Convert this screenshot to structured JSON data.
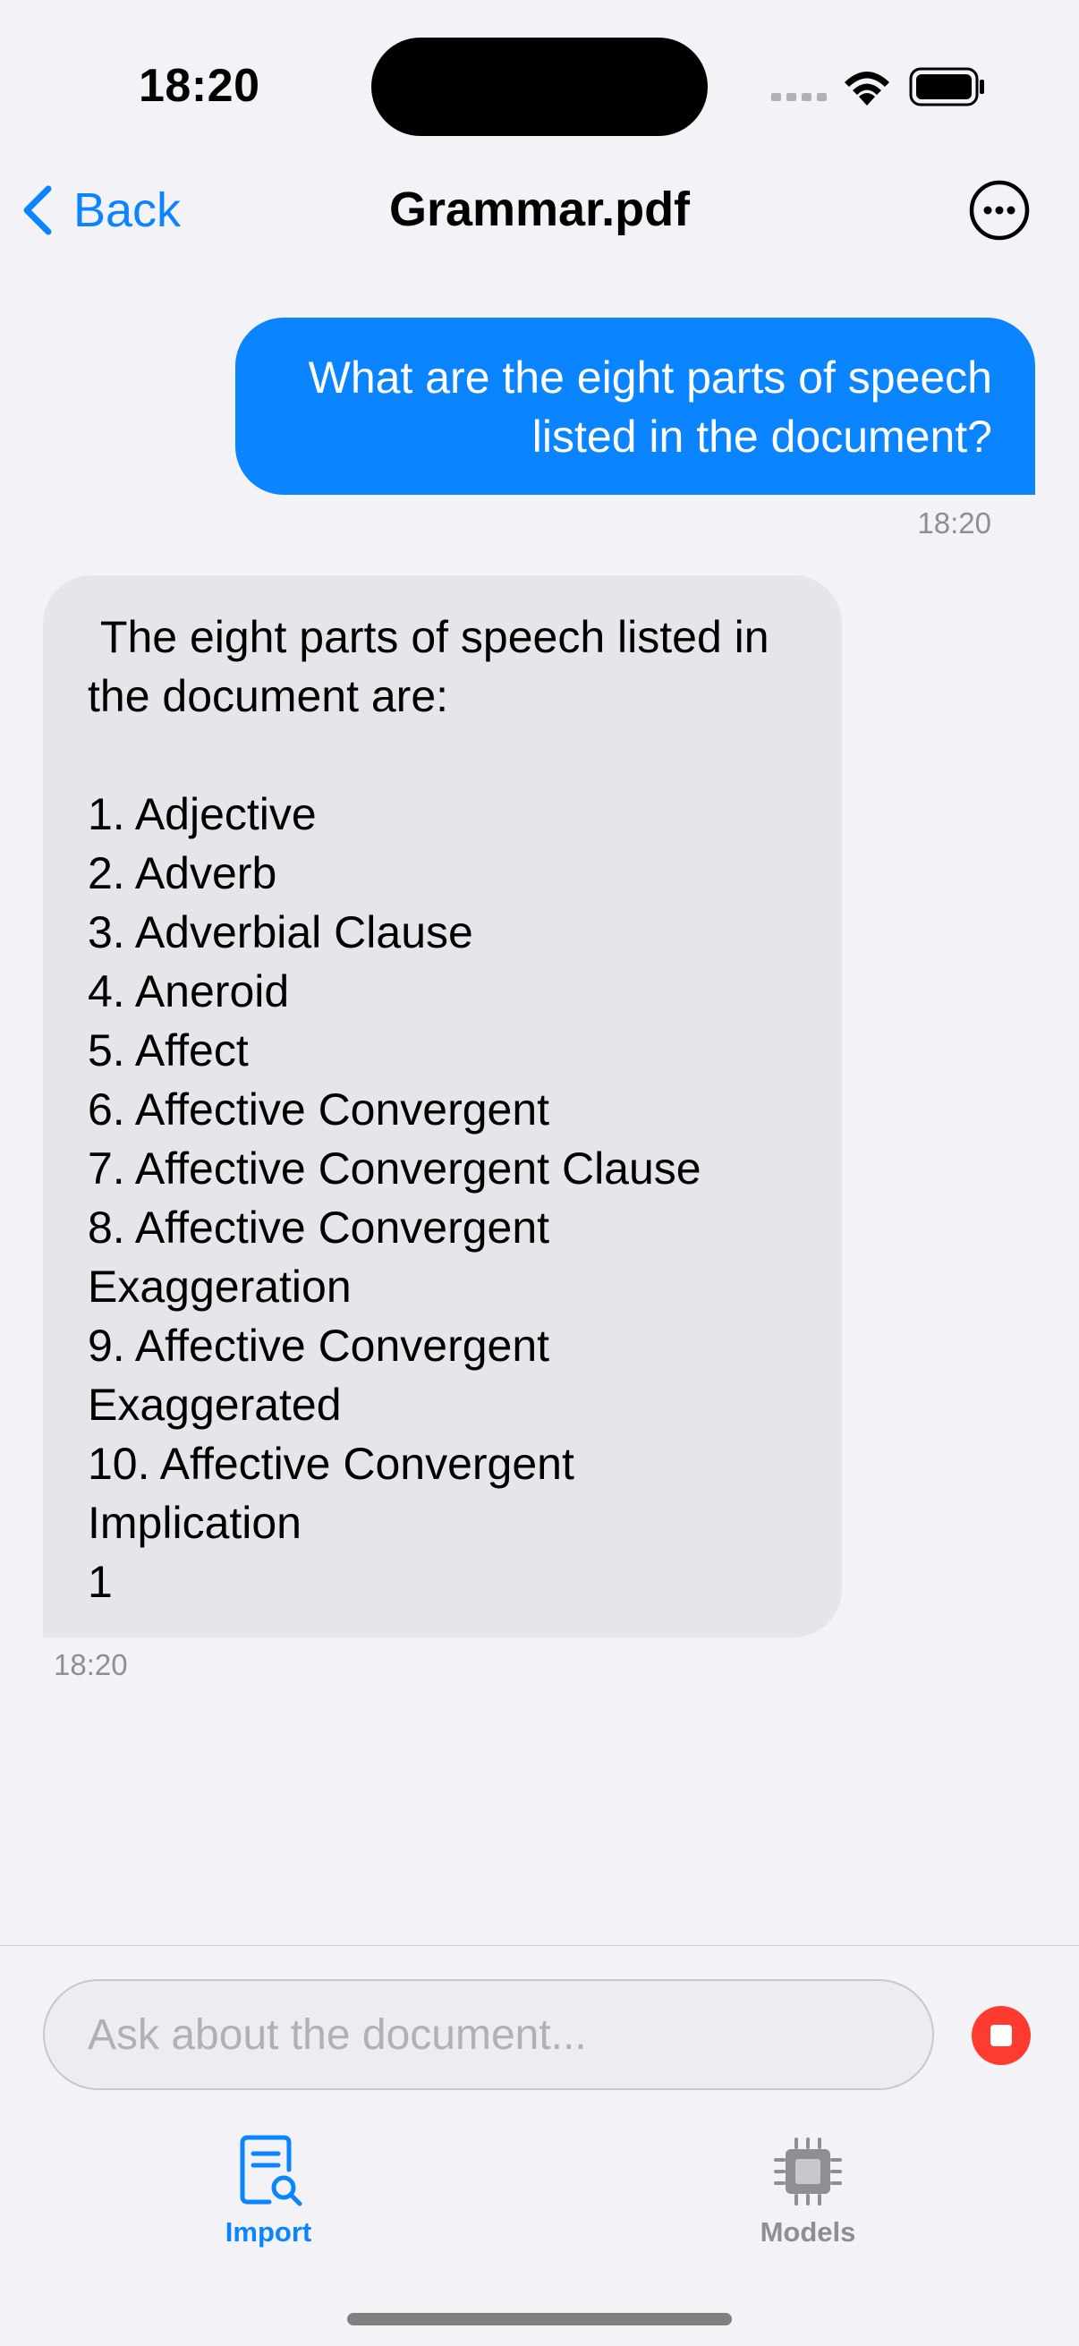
{
  "status_bar": {
    "time": "18:20"
  },
  "nav": {
    "back_label": "Back",
    "title": "Grammar.pdf"
  },
  "messages": [
    {
      "role": "user",
      "text": "What are the eight parts of speech listed in the document?",
      "time": "18:20"
    },
    {
      "role": "assistant",
      "text": " The eight parts of speech listed in the document are:\n\n1. Adjective\n2. Adverb\n3. Adverbial Clause\n4. Aneroid\n5. Affect\n6. Affective Convergent\n7. Affective Convergent Clause\n8. Affective Convergent Exaggeration\n9. Affective Convergent Exaggerated\n10. Affective Convergent Implication\n1",
      "time": "18:20"
    }
  ],
  "input": {
    "placeholder": "Ask about the document..."
  },
  "tabs": [
    {
      "label": "Import",
      "icon": "document-search-icon",
      "active": true
    },
    {
      "label": "Models",
      "icon": "cpu-chip-icon",
      "active": false
    }
  ],
  "colors": {
    "accent": "#0a84ff",
    "user_bubble": "#0a84ff",
    "assistant_bubble": "#e5e5ea",
    "background": "#f2f2f7",
    "stop": "#ff3b30",
    "inactive": "#8e8e93"
  }
}
